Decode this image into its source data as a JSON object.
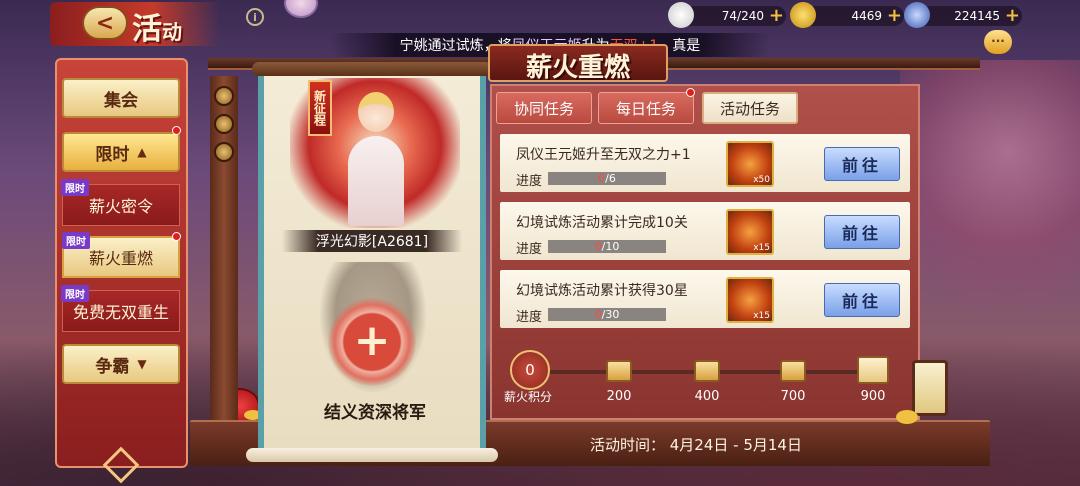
{
  "header": {
    "title": "活",
    "title_small": "动",
    "back_icon": "back-arrow-icon",
    "info_icon": "info-icon"
  },
  "resources": [
    {
      "icon": "steamed-bun-icon",
      "value": "74/240"
    },
    {
      "icon": "gold-ingot-icon",
      "value": "4469"
    },
    {
      "icon": "coin-icon",
      "value": "224145"
    }
  ],
  "ticker": {
    "prefix": "宁姚通过试炼，将",
    "name": "凤仪王元姬",
    "middle": "升为",
    "rank": "无双+1",
    "suffix": "，真是"
  },
  "sidebar": {
    "items": [
      {
        "label": "集会"
      },
      {
        "label": "限时"
      },
      {
        "tag": "限时",
        "label": "薪火密令"
      },
      {
        "tag": "限时",
        "label": "薪火重燃"
      },
      {
        "tag": "限时",
        "label": "免费无双重生"
      },
      {
        "label": "争霸"
      }
    ]
  },
  "hero": {
    "badge": "新征程",
    "name": "浮光幻影[A2681]",
    "slot_label": "结义资深将军"
  },
  "panel": {
    "title": "薪火重燃",
    "tabs": [
      {
        "label": "协同任务"
      },
      {
        "label": "每日任务"
      },
      {
        "label": "活动任务"
      }
    ],
    "tasks": [
      {
        "name": "凤仪王元姬升至无双之力+1",
        "progress_label": "进度",
        "current": "0",
        "total": "/6",
        "reward_qty": "x50",
        "button": "前往"
      },
      {
        "name": "幻境试炼活动累计完成10关",
        "progress_label": "进度",
        "current": "0",
        "total": "/10",
        "reward_qty": "x15",
        "button": "前往"
      },
      {
        "name": "幻境试炼活动累计获得30星",
        "progress_label": "进度",
        "current": "0",
        "total": "/30",
        "reward_qty": "x15",
        "button": "前往"
      }
    ],
    "points_value": "0",
    "points_label": "薪火积分",
    "milestones": [
      "200",
      "400",
      "700",
      "900"
    ],
    "time_text": "活动时间： 4月24日 - 5月14日"
  },
  "colors": {
    "accent_red": "#c43a2a",
    "go_button": "#7aa0e8",
    "progress_current": "#ff4a3a"
  }
}
